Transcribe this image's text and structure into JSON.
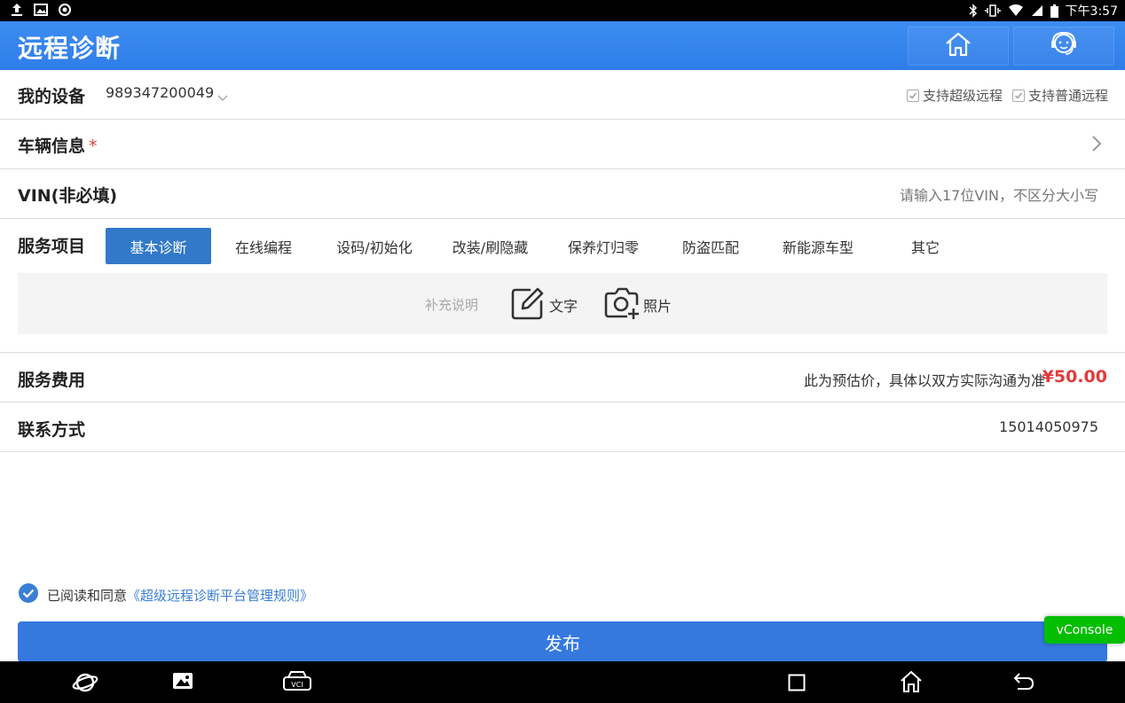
{
  "status_bar": {
    "time": "下午3:57"
  },
  "header": {
    "title": "远程诊断"
  },
  "device": {
    "label": "我的设备",
    "value": "989347200049",
    "options": [
      {
        "label": "支持超级远程",
        "checked": true
      },
      {
        "label": "支持普通远程",
        "checked": true
      }
    ]
  },
  "vehicle": {
    "label": "车辆信息",
    "required_mark": "*"
  },
  "vin": {
    "label": "VIN(非必填)",
    "placeholder": "请输入17位VIN，不区分大小写"
  },
  "service": {
    "label": "服务项目",
    "tabs": [
      {
        "label": "基本诊断",
        "active": true
      },
      {
        "label": "在线编程",
        "active": false
      },
      {
        "label": "设码/初始化",
        "active": false
      },
      {
        "label": "改装/刷隐藏",
        "active": false
      },
      {
        "label": "保养灯归零",
        "active": false
      },
      {
        "label": "防盗匹配",
        "active": false
      },
      {
        "label": "新能源车型",
        "active": false
      },
      {
        "label": "其它",
        "active": false
      }
    ],
    "supplement": {
      "hint": "补充说明",
      "text_label": "文字",
      "photo_label": "照片"
    }
  },
  "fee": {
    "label": "服务费用",
    "note": "此为预估价，具体以双方实际沟通为准",
    "value": "¥50.00"
  },
  "contact": {
    "label": "联系方式",
    "value": "15014050975"
  },
  "agreement": {
    "checked": true,
    "text": "已阅读和同意",
    "link": "《超级远程诊断平台管理规则》"
  },
  "publish_button": {
    "label": "发布"
  },
  "vconsole": {
    "label": "vConsole"
  },
  "colors": {
    "header": "#3d8df2",
    "primary": "#3579df",
    "price": "#e23b3b",
    "vconsole": "#04be02"
  }
}
